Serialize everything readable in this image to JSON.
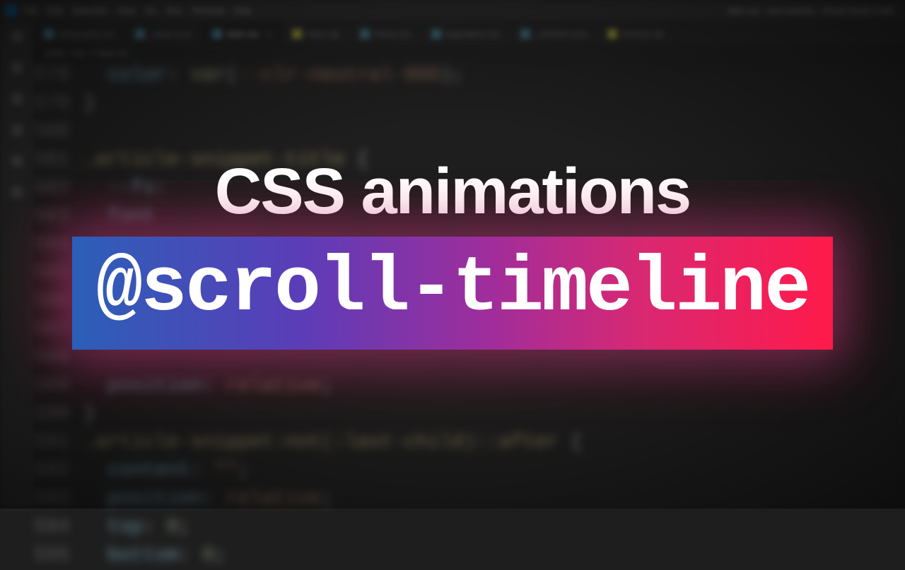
{
  "title_bar": {
    "menu": [
      "File",
      "Edit",
      "Selection",
      "View",
      "Go",
      "Run",
      "Terminal",
      "Help"
    ],
    "right": "style.css - new-website - Visual Studio Code"
  },
  "tabs": [
    {
      "label": "typography.css",
      "icon": "css",
      "active": false
    },
    {
      "label": "_base.scss",
      "icon": "css",
      "active": false
    },
    {
      "label": "style.css",
      "icon": "css",
      "active": true
    },
    {
      "label": "index.njk",
      "icon": "js",
      "active": false
    },
    {
      "label": "home.css",
      "icon": "css",
      "active": false
    },
    {
      "label": "pagination.css",
      "icon": "css",
      "active": false
    },
    {
      "label": "_reviews.scss",
      "icon": "css",
      "active": false
    },
    {
      "label": "reviews.njk",
      "icon": "js",
      "active": false
    }
  ],
  "breadcrumb": "public › css › # style.css",
  "code": {
    "lines": [
      {
        "num": "578",
        "html": "  <span class='tok-property'>color</span><span class='tok-punct'>:</span> <span class='tok-func'>var</span><span class='tok-punct'>(</span><span class='tok-var'>--clr-neutral-900</span><span class='tok-punct'>);</span>"
      },
      {
        "num": "579",
        "html": "<span class='tok-punct'>}</span>"
      },
      {
        "num": "580",
        "html": ""
      },
      {
        "num": "581",
        "html": "<span class='tok-selector'>.article-snippet-title</span> <span class='tok-punct'>{</span>"
      },
      {
        "num": "582",
        "html": "  <span class='tok-property'>--fs</span><span class='tok-punct'>:</span>"
      },
      {
        "num": "583",
        "html": "  <span class='tok-property'>font</span>"
      },
      {
        "num": "584",
        "html": ""
      },
      {
        "num": "585",
        "html": ""
      },
      {
        "num": "586",
        "html": ""
      },
      {
        "num": "587",
        "html": ""
      },
      {
        "num": "588",
        "html": ""
      },
      {
        "num": "589",
        "html": "  <span class='tok-property'>position</span><span class='tok-punct'>:</span> <span class='tok-var'>relative</span><span class='tok-punct'>;</span>"
      },
      {
        "num": "590",
        "html": "<span class='tok-punct'>}</span>"
      },
      {
        "num": "591",
        "html": "<span class='tok-selector'>.article-snippet:not(:last-child)::after</span> <span class='tok-punct'>{</span>"
      },
      {
        "num": "592",
        "html": "  <span class='tok-property'>content</span><span class='tok-punct'>:</span> <span class='tok-string'>\"\"</span><span class='tok-punct'>;</span>"
      },
      {
        "num": "593",
        "html": "  <span class='tok-property'>position</span><span class='tok-punct'>:</span> <span class='tok-var'>relative</span><span class='tok-punct'>;</span>"
      },
      {
        "num": "594",
        "html": "  <span class='tok-property'>top</span><span class='tok-punct'>:</span> <span class='tok-num'>0</span><span class='tok-punct'>;</span>"
      },
      {
        "num": "595",
        "html": "  <span class='tok-property'>bottom</span><span class='tok-punct'>:</span> <span class='tok-num'>0</span><span class='tok-punct'>;</span>"
      }
    ]
  },
  "overlay": {
    "headline": "CSS animations",
    "code_text": "@scroll-timeline"
  },
  "activity_icons": [
    "files-icon",
    "search-icon",
    "source-control-icon",
    "debug-icon",
    "extensions-icon",
    "account-icon"
  ]
}
